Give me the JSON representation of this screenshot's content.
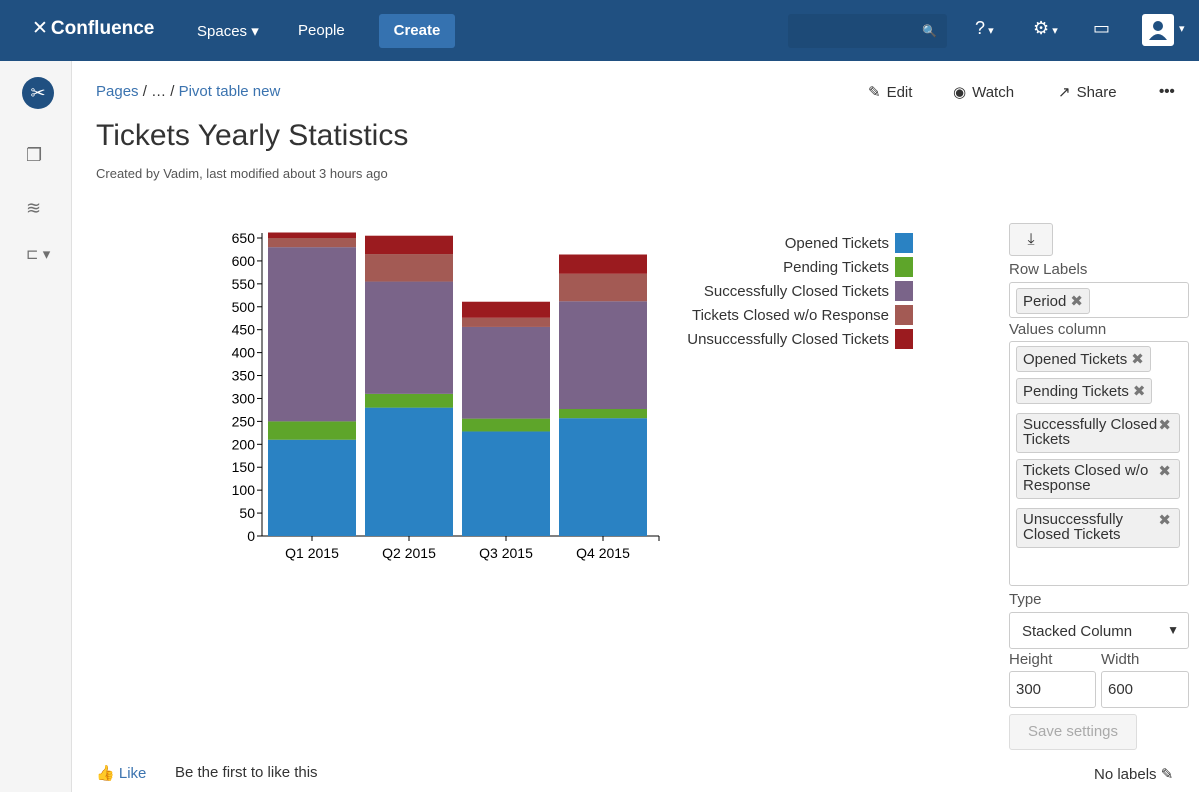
{
  "app": {
    "logo": "Confluence",
    "nav": {
      "spaces": "Spaces",
      "people": "People",
      "create": "Create"
    },
    "colors": {
      "nav_bg": "#205081",
      "create_bg": "#3572b0",
      "link": "#3b73af"
    },
    "icons": {
      "search": "search-icon",
      "help": "help-icon",
      "settings": "gear-icon",
      "notifications": "notifications-icon",
      "user": "user-avatar-icon"
    }
  },
  "sidebar": {
    "icons": [
      "space-logo-icon",
      "pages-icon",
      "feed-icon",
      "page-tree-icon"
    ]
  },
  "page": {
    "breadcrumb": {
      "root": "Pages",
      "ellipsis": "…",
      "current": "Pivot table new"
    },
    "actions": {
      "edit": "Edit",
      "watch": "Watch",
      "share": "Share",
      "more": "•••"
    },
    "title": "Tickets Yearly Statistics",
    "meta": "Created by Vadim, last modified about 3 hours ago"
  },
  "chart_data": {
    "type": "bar",
    "stacked": true,
    "categories": [
      "Q1 2015",
      "Q2 2015",
      "Q3 2015",
      "Q4 2015"
    ],
    "series": [
      {
        "name": "Opened Tickets",
        "color": "#2a82c3",
        "values": [
          210,
          280,
          228,
          257
        ]
      },
      {
        "name": "Pending Tickets",
        "color": "#5ea52a",
        "values": [
          40,
          30,
          28,
          20
        ]
      },
      {
        "name": "Successfully Closed Tickets",
        "color": "#7a6489",
        "values": [
          380,
          245,
          200,
          235
        ]
      },
      {
        "name": "Tickets Closed w/o Response",
        "color": "#a35a54",
        "values": [
          20,
          60,
          20,
          60
        ]
      },
      {
        "name": "Unsuccessfully Closed Tickets",
        "color": "#9b1b1f",
        "values": [
          12,
          40,
          35,
          42
        ]
      }
    ],
    "yticks": [
      "0",
      "50",
      "100",
      "150",
      "200",
      "250",
      "300",
      "350",
      "400",
      "450",
      "500",
      "550",
      "600",
      "650"
    ],
    "ylim": [
      0,
      650
    ],
    "legend_position": "top-right"
  },
  "panel": {
    "row_labels_title": "Row Labels",
    "row_labels": [
      "Period"
    ],
    "values_column_title": "Values column",
    "values": [
      "Opened Tickets",
      "Pending Tickets",
      "Successfully Closed Tickets",
      "Tickets Closed w/o Response",
      "Unsuccessfully Closed Tickets"
    ],
    "type_title": "Type",
    "type_value": "Stacked Column",
    "height_title": "Height",
    "height_value": "300",
    "width_title": "Width",
    "width_value": "600",
    "save": "Save settings"
  },
  "footer": {
    "like": "Like",
    "like_msg": "Be the first to like this",
    "labels": "No labels"
  }
}
